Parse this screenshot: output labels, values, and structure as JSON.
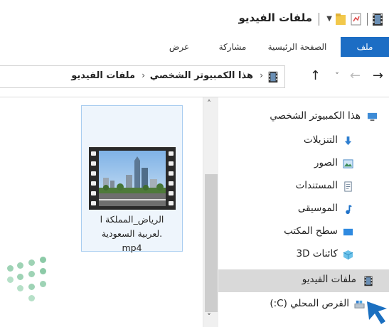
{
  "window": {
    "title": "ملفات الفيديو"
  },
  "ribbon": {
    "tabs": [
      "ملف",
      "الصفحة الرئيسية",
      "مشاركة",
      "عرض"
    ]
  },
  "address_bar": {
    "crumbs": [
      "هذا الكمبيوتر الشخصي",
      "ملفات الفيديو"
    ]
  },
  "file": {
    "name_line1": "الرياض_المملكة ا",
    "name_line2": ".لعربية السعودية",
    "name_line3": "mp4"
  },
  "nav_pane": {
    "items": [
      {
        "label": "هذا الكمبيوتر الشخصي",
        "icon": "computer-icon"
      },
      {
        "label": "التنزيلات",
        "icon": "downloads-icon"
      },
      {
        "label": "الصور",
        "icon": "pictures-icon"
      },
      {
        "label": "المستندات",
        "icon": "documents-icon"
      },
      {
        "label": "الموسيقى",
        "icon": "music-icon"
      },
      {
        "label": "سطح المكتب",
        "icon": "desktop-icon"
      },
      {
        "label": "كائنات 3D",
        "icon": "3d-objects-icon"
      },
      {
        "label": "ملفات الفيديو",
        "icon": "videos-icon",
        "selected": true
      },
      {
        "label": "القرص المحلي (C:)",
        "icon": "drive-icon"
      }
    ]
  },
  "colors": {
    "file_tab": "#1c6dc4",
    "selection": "#d9d9d9",
    "card_border": "#a9cdf0",
    "card_bg": "#eef5fc",
    "cursor": "#1a6fc0",
    "watermark": "#9ed3b5"
  }
}
